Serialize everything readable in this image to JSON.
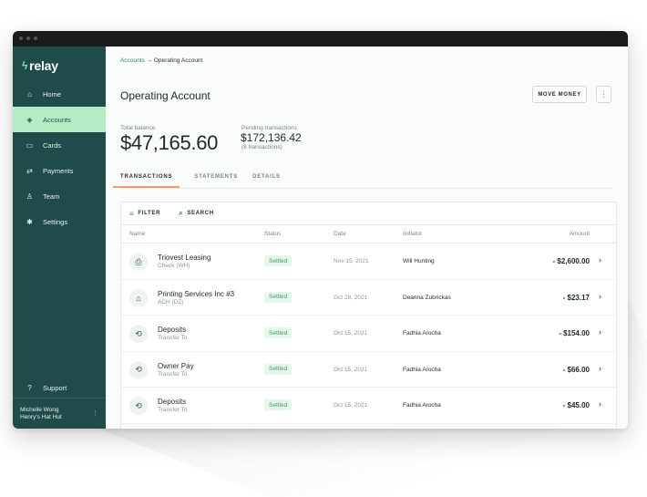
{
  "brand": {
    "name": "relay",
    "logo_mark": "bolt"
  },
  "sidebar": {
    "items": [
      {
        "label": "Home",
        "icon": "home-icon",
        "glyph": "⌂"
      },
      {
        "label": "Accounts",
        "icon": "layers-icon",
        "glyph": "◈",
        "active": true
      },
      {
        "label": "Cards",
        "icon": "card-icon",
        "glyph": "▭"
      },
      {
        "label": "Payments",
        "icon": "transfer-icon",
        "glyph": "⇄"
      },
      {
        "label": "Team",
        "icon": "user-icon",
        "glyph": "♙"
      },
      {
        "label": "Settings",
        "icon": "gear-icon",
        "glyph": "✱"
      }
    ],
    "support": {
      "label": "Support",
      "icon": "help-icon",
      "glyph": "?"
    },
    "user": {
      "name": "Michelle Wong",
      "org": "Henry's Hat Hut"
    }
  },
  "breadcrumb": {
    "parent": "Accounts",
    "separator": "→",
    "current": "Operating Account"
  },
  "page": {
    "title": "Operating Account",
    "move_money_label": "MOVE MONEY",
    "more_glyph": "⋮"
  },
  "balances": {
    "total_label": "Total balance",
    "total_value": "$47,165.60",
    "pending_label": "Pending transactions",
    "pending_value": "$172,136.42",
    "pending_sub": "(8 transactions)"
  },
  "tabs": [
    {
      "label": "TRANSACTIONS",
      "active": true
    },
    {
      "label": "STATEMENTS"
    },
    {
      "label": "DETAILS"
    }
  ],
  "toolbar": {
    "filter_label": "FILTER",
    "search_label": "SEARCH"
  },
  "table": {
    "columns": [
      "Name",
      "Status",
      "Date",
      "Initiator",
      "Amount"
    ],
    "rows": [
      {
        "icon": "check-deposit-icon",
        "glyph": "⎙",
        "name": "Triovest Leasing",
        "sub": "Check (WH)",
        "status": "Settled",
        "date": "Nov 15, 2021",
        "initiator": "Will Hunting",
        "amount": "- $2,600.00"
      },
      {
        "icon": "bank-icon",
        "glyph": "⌂",
        "name": "Printing Services Inc #3",
        "sub": "ACH (DZ)",
        "status": "Settled",
        "date": "Oct 28, 2021",
        "initiator": "Deanna Zubrickas",
        "amount": "- $23.17"
      },
      {
        "icon": "transfer-icon",
        "glyph": "⟲",
        "name": "Deposits",
        "sub": "Transfer To",
        "status": "Settled",
        "date": "Oct 15, 2021",
        "initiator": "Fadhia Arocha",
        "amount": "- $154.00"
      },
      {
        "icon": "transfer-icon",
        "glyph": "⟲",
        "name": "Owner Pay",
        "sub": "Transfer To",
        "status": "Settled",
        "date": "Oct 15, 2021",
        "initiator": "Fadhia Arocha",
        "amount": "- $66.00"
      },
      {
        "icon": "transfer-icon",
        "glyph": "⟲",
        "name": "Deposits",
        "sub": "Transfer To",
        "status": "Settled",
        "date": "Oct 15, 2021",
        "initiator": "Fadhia Arocha",
        "amount": "- $45.00"
      }
    ]
  },
  "colors": {
    "sidebar": "#1f4c4a",
    "active_nav": "#b5ecc6",
    "accent": "#2a8b6f",
    "settled_bg": "#e5f6ea",
    "settled_text": "#3e9e62",
    "tab_underline": "#e8a070"
  }
}
